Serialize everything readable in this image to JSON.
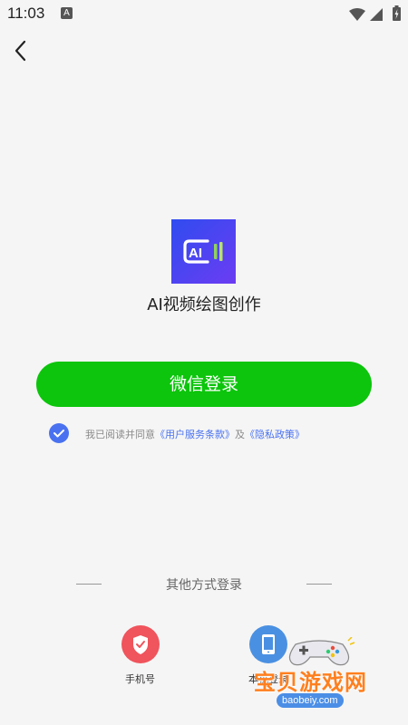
{
  "status_bar": {
    "time": "11:03",
    "notification_badge": "A"
  },
  "app": {
    "name": "AI视频绘图创作",
    "logo_text": "AI"
  },
  "login": {
    "wechat_button": "微信登录"
  },
  "agreement": {
    "prefix": "我已阅读并同意",
    "terms_link": "《用户服务条款》",
    "conjunction": "及",
    "privacy_link": "《隐私政策》"
  },
  "other_login": {
    "title": "其他方式登录",
    "options": [
      {
        "label": "手机号",
        "icon": "shield-icon",
        "color": "#f0545c"
      },
      {
        "label": "本机登录",
        "icon": "phone-icon",
        "color": "#4a90e2"
      }
    ]
  },
  "watermark": {
    "text": "宝贝游戏网",
    "url": "baobeiy.com"
  },
  "colors": {
    "wechat_green": "#0cc50c",
    "link_blue": "#4a72f0",
    "logo_gradient_start": "#2f4cf0",
    "logo_gradient_end": "#6c3cf2"
  }
}
